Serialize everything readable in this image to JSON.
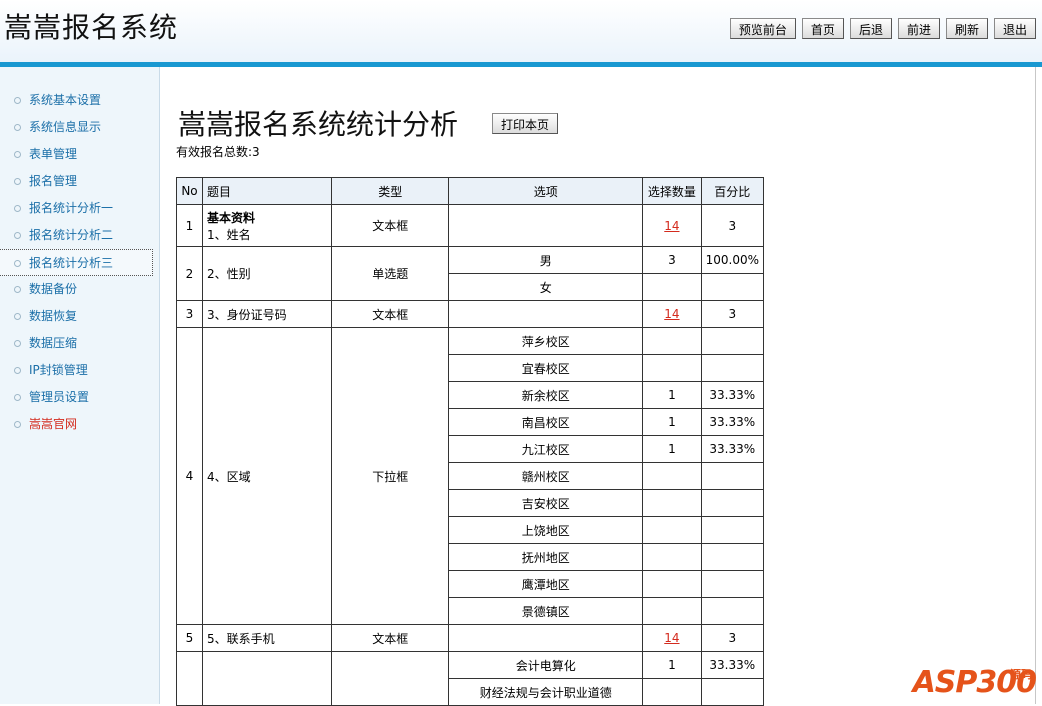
{
  "app": {
    "title": "嵩嵩报名系统"
  },
  "toolbar": {
    "buttons": [
      {
        "label": "预览前台"
      },
      {
        "label": "首页"
      },
      {
        "label": "后退"
      },
      {
        "label": "前进"
      },
      {
        "label": "刷新"
      },
      {
        "label": "退出"
      }
    ]
  },
  "sidebar": {
    "items": [
      {
        "label": "系统基本设置"
      },
      {
        "label": "系统信息显示"
      },
      {
        "label": "表单管理"
      },
      {
        "label": "报名管理"
      },
      {
        "label": "报名统计分析一"
      },
      {
        "label": "报名统计分析二"
      },
      {
        "label": "报名统计分析三"
      },
      {
        "label": "数据备份"
      },
      {
        "label": "数据恢复"
      },
      {
        "label": "数据压缩"
      },
      {
        "label": "IP封锁管理"
      },
      {
        "label": "管理员设置"
      },
      {
        "label": "嵩嵩官网"
      }
    ],
    "active_index": 6
  },
  "main": {
    "title": "嵩嵩报名系统统计分析",
    "print_label": "打印本页",
    "total_text": "有效报名总数:3",
    "table": {
      "headers": [
        "No",
        "题目",
        "类型",
        "选项",
        "选择数量",
        "百分比"
      ],
      "q1": {
        "no": "1",
        "group": "基本资料",
        "question": "1、姓名",
        "type": "文本框",
        "count": "14",
        "percent": "3"
      },
      "q2": {
        "no": "2",
        "question": "2、性别",
        "type": "单选题",
        "options": [
          {
            "label": "男",
            "count": "3",
            "percent": "100.00%"
          },
          {
            "label": "女",
            "count": "",
            "percent": ""
          }
        ]
      },
      "q3": {
        "no": "3",
        "question": "3、身份证号码",
        "type": "文本框",
        "count": "14",
        "percent": "3"
      },
      "q4": {
        "no": "4",
        "question": "4、区域",
        "type": "下拉框",
        "options": [
          {
            "label": "萍乡校区",
            "count": "",
            "percent": ""
          },
          {
            "label": "宜春校区",
            "count": "",
            "percent": ""
          },
          {
            "label": "新余校区",
            "count": "1",
            "percent": "33.33%"
          },
          {
            "label": "南昌校区",
            "count": "1",
            "percent": "33.33%"
          },
          {
            "label": "九江校区",
            "count": "1",
            "percent": "33.33%"
          },
          {
            "label": "赣州校区",
            "count": "",
            "percent": ""
          },
          {
            "label": "吉安校区",
            "count": "",
            "percent": ""
          },
          {
            "label": "上饶地区",
            "count": "",
            "percent": ""
          },
          {
            "label": "抚州地区",
            "count": "",
            "percent": ""
          },
          {
            "label": "鹰潭地区",
            "count": "",
            "percent": ""
          },
          {
            "label": "景德镇区",
            "count": "",
            "percent": ""
          }
        ]
      },
      "q5": {
        "no": "5",
        "question": "5、联系手机",
        "type": "文本框",
        "count": "14",
        "percent": "3"
      },
      "q6": {
        "options": [
          {
            "label": "会计电算化",
            "count": "1",
            "percent": "33.33%"
          },
          {
            "label": "财经法规与会计职业道德",
            "count": "",
            "percent": ""
          }
        ]
      }
    }
  },
  "watermark": {
    "text": "ASP300",
    "side": "源码"
  }
}
